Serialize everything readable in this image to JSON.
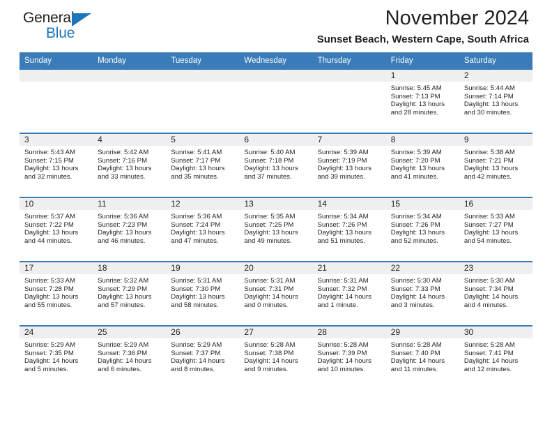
{
  "brand": {
    "name_top": "General",
    "name_bottom": "Blue",
    "accent_color": "#1b75bb"
  },
  "header": {
    "title": "November 2024",
    "subtitle": "Sunset Beach, Western Cape, South Africa"
  },
  "theme": {
    "header_blue": "#3a7cb9",
    "daynum_band": "#efefef",
    "text": "#231f20"
  },
  "weekday_headers": [
    "Sunday",
    "Monday",
    "Tuesday",
    "Wednesday",
    "Thursday",
    "Friday",
    "Saturday"
  ],
  "labels": {
    "sunrise_prefix": "Sunrise:",
    "sunset_prefix": "Sunset:",
    "daylight_prefix": "Daylight:"
  },
  "weeks": [
    [
      {
        "day": "",
        "empty": true
      },
      {
        "day": "",
        "empty": true
      },
      {
        "day": "",
        "empty": true
      },
      {
        "day": "",
        "empty": true
      },
      {
        "day": "",
        "empty": true
      },
      {
        "day": "1",
        "sunrise": "Sunrise: 5:45 AM",
        "sunset": "Sunset: 7:13 PM",
        "daylight": "Daylight: 13 hours and 28 minutes."
      },
      {
        "day": "2",
        "sunrise": "Sunrise: 5:44 AM",
        "sunset": "Sunset: 7:14 PM",
        "daylight": "Daylight: 13 hours and 30 minutes."
      }
    ],
    [
      {
        "day": "3",
        "sunrise": "Sunrise: 5:43 AM",
        "sunset": "Sunset: 7:15 PM",
        "daylight": "Daylight: 13 hours and 32 minutes."
      },
      {
        "day": "4",
        "sunrise": "Sunrise: 5:42 AM",
        "sunset": "Sunset: 7:16 PM",
        "daylight": "Daylight: 13 hours and 33 minutes."
      },
      {
        "day": "5",
        "sunrise": "Sunrise: 5:41 AM",
        "sunset": "Sunset: 7:17 PM",
        "daylight": "Daylight: 13 hours and 35 minutes."
      },
      {
        "day": "6",
        "sunrise": "Sunrise: 5:40 AM",
        "sunset": "Sunset: 7:18 PM",
        "daylight": "Daylight: 13 hours and 37 minutes."
      },
      {
        "day": "7",
        "sunrise": "Sunrise: 5:39 AM",
        "sunset": "Sunset: 7:19 PM",
        "daylight": "Daylight: 13 hours and 39 minutes."
      },
      {
        "day": "8",
        "sunrise": "Sunrise: 5:39 AM",
        "sunset": "Sunset: 7:20 PM",
        "daylight": "Daylight: 13 hours and 41 minutes."
      },
      {
        "day": "9",
        "sunrise": "Sunrise: 5:38 AM",
        "sunset": "Sunset: 7:21 PM",
        "daylight": "Daylight: 13 hours and 42 minutes."
      }
    ],
    [
      {
        "day": "10",
        "sunrise": "Sunrise: 5:37 AM",
        "sunset": "Sunset: 7:22 PM",
        "daylight": "Daylight: 13 hours and 44 minutes."
      },
      {
        "day": "11",
        "sunrise": "Sunrise: 5:36 AM",
        "sunset": "Sunset: 7:23 PM",
        "daylight": "Daylight: 13 hours and 46 minutes."
      },
      {
        "day": "12",
        "sunrise": "Sunrise: 5:36 AM",
        "sunset": "Sunset: 7:24 PM",
        "daylight": "Daylight: 13 hours and 47 minutes."
      },
      {
        "day": "13",
        "sunrise": "Sunrise: 5:35 AM",
        "sunset": "Sunset: 7:25 PM",
        "daylight": "Daylight: 13 hours and 49 minutes."
      },
      {
        "day": "14",
        "sunrise": "Sunrise: 5:34 AM",
        "sunset": "Sunset: 7:26 PM",
        "daylight": "Daylight: 13 hours and 51 minutes."
      },
      {
        "day": "15",
        "sunrise": "Sunrise: 5:34 AM",
        "sunset": "Sunset: 7:26 PM",
        "daylight": "Daylight: 13 hours and 52 minutes."
      },
      {
        "day": "16",
        "sunrise": "Sunrise: 5:33 AM",
        "sunset": "Sunset: 7:27 PM",
        "daylight": "Daylight: 13 hours and 54 minutes."
      }
    ],
    [
      {
        "day": "17",
        "sunrise": "Sunrise: 5:33 AM",
        "sunset": "Sunset: 7:28 PM",
        "daylight": "Daylight: 13 hours and 55 minutes."
      },
      {
        "day": "18",
        "sunrise": "Sunrise: 5:32 AM",
        "sunset": "Sunset: 7:29 PM",
        "daylight": "Daylight: 13 hours and 57 minutes."
      },
      {
        "day": "19",
        "sunrise": "Sunrise: 5:31 AM",
        "sunset": "Sunset: 7:30 PM",
        "daylight": "Daylight: 13 hours and 58 minutes."
      },
      {
        "day": "20",
        "sunrise": "Sunrise: 5:31 AM",
        "sunset": "Sunset: 7:31 PM",
        "daylight": "Daylight: 14 hours and 0 minutes."
      },
      {
        "day": "21",
        "sunrise": "Sunrise: 5:31 AM",
        "sunset": "Sunset: 7:32 PM",
        "daylight": "Daylight: 14 hours and 1 minute."
      },
      {
        "day": "22",
        "sunrise": "Sunrise: 5:30 AM",
        "sunset": "Sunset: 7:33 PM",
        "daylight": "Daylight: 14 hours and 3 minutes."
      },
      {
        "day": "23",
        "sunrise": "Sunrise: 5:30 AM",
        "sunset": "Sunset: 7:34 PM",
        "daylight": "Daylight: 14 hours and 4 minutes."
      }
    ],
    [
      {
        "day": "24",
        "sunrise": "Sunrise: 5:29 AM",
        "sunset": "Sunset: 7:35 PM",
        "daylight": "Daylight: 14 hours and 5 minutes."
      },
      {
        "day": "25",
        "sunrise": "Sunrise: 5:29 AM",
        "sunset": "Sunset: 7:36 PM",
        "daylight": "Daylight: 14 hours and 6 minutes."
      },
      {
        "day": "26",
        "sunrise": "Sunrise: 5:29 AM",
        "sunset": "Sunset: 7:37 PM",
        "daylight": "Daylight: 14 hours and 8 minutes."
      },
      {
        "day": "27",
        "sunrise": "Sunrise: 5:28 AM",
        "sunset": "Sunset: 7:38 PM",
        "daylight": "Daylight: 14 hours and 9 minutes."
      },
      {
        "day": "28",
        "sunrise": "Sunrise: 5:28 AM",
        "sunset": "Sunset: 7:39 PM",
        "daylight": "Daylight: 14 hours and 10 minutes."
      },
      {
        "day": "29",
        "sunrise": "Sunrise: 5:28 AM",
        "sunset": "Sunset: 7:40 PM",
        "daylight": "Daylight: 14 hours and 11 minutes."
      },
      {
        "day": "30",
        "sunrise": "Sunrise: 5:28 AM",
        "sunset": "Sunset: 7:41 PM",
        "daylight": "Daylight: 14 hours and 12 minutes."
      }
    ]
  ]
}
